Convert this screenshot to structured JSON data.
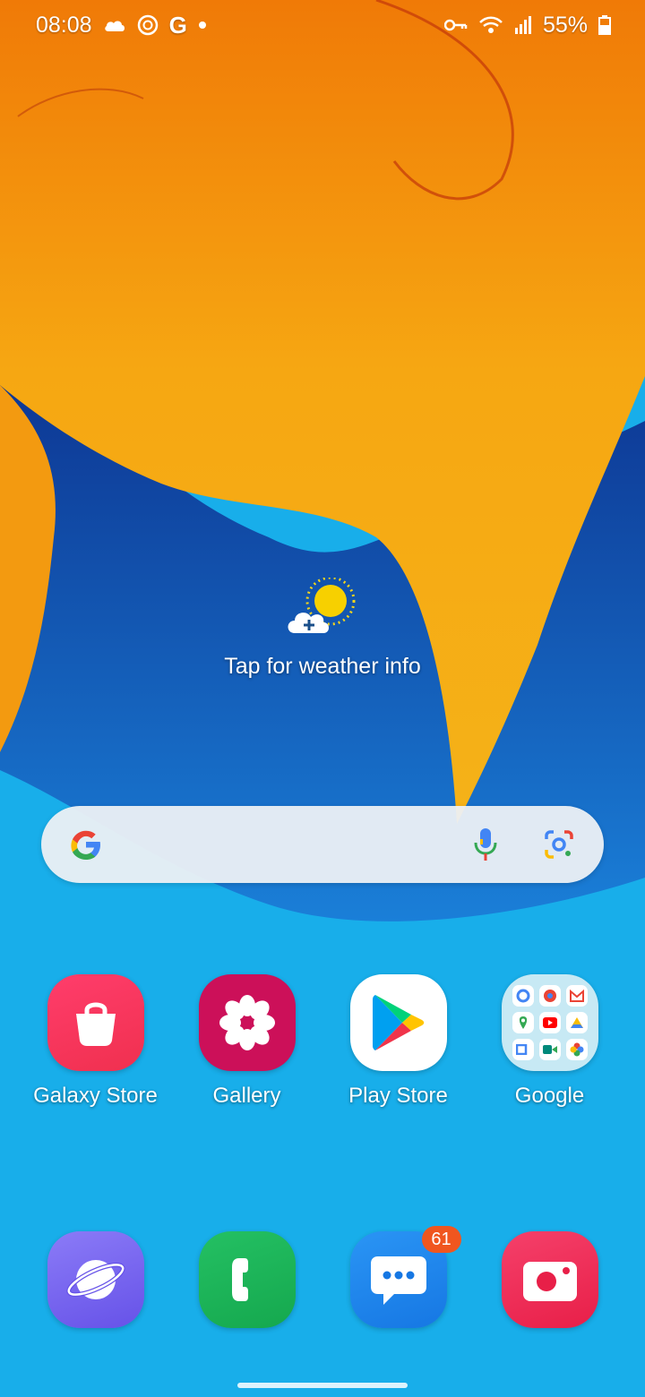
{
  "status_bar": {
    "time": "08:08",
    "battery": "55%",
    "left_icons": [
      "cloud-icon",
      "aperture-icon",
      "google-g-icon",
      "notification-dot-icon"
    ],
    "right_icons": [
      "vpn-key-icon",
      "wifi-icon",
      "signal-icon",
      "battery-icon"
    ]
  },
  "weather": {
    "text": "Tap for weather info",
    "icon": "weather-partly-sunny-icon"
  },
  "search": {
    "placeholder": "",
    "icons": [
      "google-logo-icon",
      "microphone-icon",
      "google-lens-icon"
    ]
  },
  "apps": [
    {
      "label": "Galaxy Store",
      "icon": "shopping-bag-icon",
      "color": "#f0304f"
    },
    {
      "label": "Gallery",
      "icon": "flower-icon",
      "color": "#cc1059"
    },
    {
      "label": "Play Store",
      "icon": "play-triangle-icon",
      "color": "#ffffff"
    },
    {
      "label": "Google",
      "icon": "google-folder-icon",
      "color": "#d7eef4"
    }
  ],
  "dock": [
    {
      "name": "Internet",
      "icon": "planet-icon",
      "color": "#7b6af2"
    },
    {
      "name": "Phone",
      "icon": "phone-handset-icon",
      "color": "#1fb65a"
    },
    {
      "name": "Messages",
      "icon": "chat-bubble-icon",
      "color": "#1e86f0",
      "badge": "61"
    },
    {
      "name": "Camera",
      "icon": "camera-icon",
      "color": "#ef2a55"
    }
  ],
  "colors": {
    "orange": "#f08a0c",
    "yellow": "#f7b514",
    "blue_dark": "#0d3a97",
    "blue_light": "#19b4ee"
  }
}
